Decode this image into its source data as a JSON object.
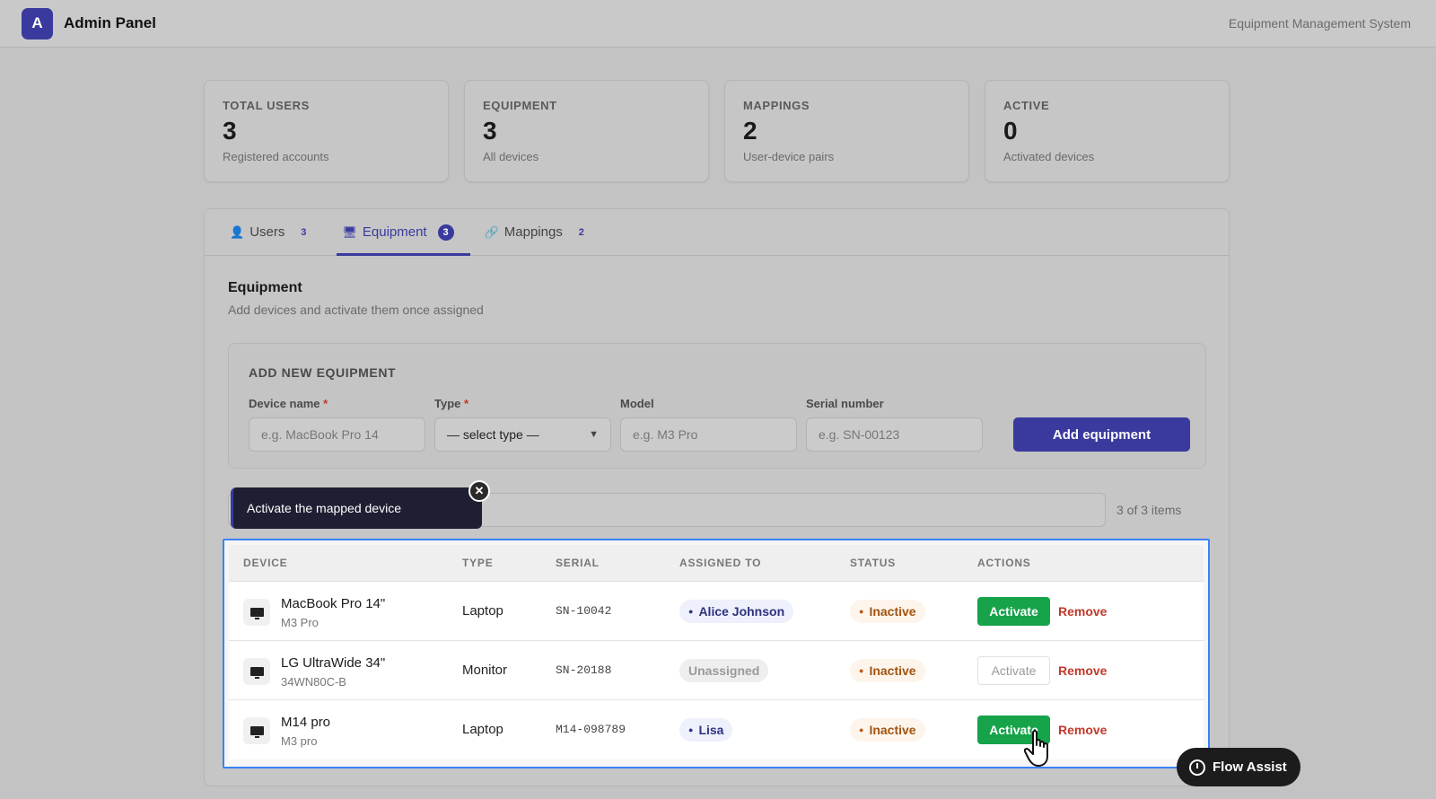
{
  "app": {
    "logo_letter": "A",
    "title": "Admin Panel",
    "system_name": "Equipment Management System"
  },
  "stats": [
    {
      "label": "TOTAL USERS",
      "value": "3",
      "sub": "Registered accounts"
    },
    {
      "label": "EQUIPMENT",
      "value": "3",
      "sub": "All devices"
    },
    {
      "label": "MAPPINGS",
      "value": "2",
      "sub": "User-device pairs"
    },
    {
      "label": "ACTIVE",
      "value": "0",
      "sub": "Activated devices"
    }
  ],
  "tabs": [
    {
      "label": "Users",
      "count": "3",
      "icon": "👤"
    },
    {
      "label": "Equipment",
      "count": "3",
      "icon": "🖥"
    },
    {
      "label": "Mappings",
      "count": "2",
      "icon": "🔗"
    }
  ],
  "section": {
    "title": "Equipment",
    "subtitle": "Add devices and activate them once assigned"
  },
  "add_form": {
    "title": "ADD NEW EQUIPMENT",
    "device_name_label": "Device name",
    "device_name_placeholder": "e.g. MacBook Pro 14",
    "type_label": "Type",
    "type_selected": "— select type —",
    "model_label": "Model",
    "model_placeholder": "e.g. M3 Pro",
    "serial_label": "Serial number",
    "serial_placeholder": "e.g. SN-00123",
    "required_mark": "*",
    "submit_label": "Add equipment"
  },
  "list": {
    "count_text": "3 of 3 items"
  },
  "tooltip": {
    "text": "Activate the mapped device",
    "close": "✕"
  },
  "table": {
    "headers": [
      "DEVICE",
      "TYPE",
      "SERIAL",
      "ASSIGNED TO",
      "STATUS",
      "ACTIONS"
    ],
    "rows": [
      {
        "name": "MacBook Pro 14\"",
        "model": "M3 Pro",
        "type": "Laptop",
        "serial": "SN-10042",
        "assigned": "Alice Johnson",
        "status": "Inactive",
        "activate": "Activate",
        "remove": "Remove"
      },
      {
        "name": "LG UltraWide 34\"",
        "model": "34WN80C-B",
        "type": "Monitor",
        "serial": "SN-20188",
        "assigned": "Unassigned",
        "status": "Inactive",
        "activate": "Activate",
        "remove": "Remove"
      },
      {
        "name": "M14 pro",
        "model": "M3 pro",
        "type": "Laptop",
        "serial": "M14-098789",
        "assigned": "Lisa",
        "status": "Inactive",
        "activate": "Activate",
        "remove": "Remove"
      }
    ]
  },
  "flow_assist": {
    "label": "Flow Assist"
  },
  "colors": {
    "accent": "#3a3a9e",
    "activate_green": "#16a34a",
    "remove_red": "#c0392b",
    "highlight_blue": "#3b82f6"
  }
}
